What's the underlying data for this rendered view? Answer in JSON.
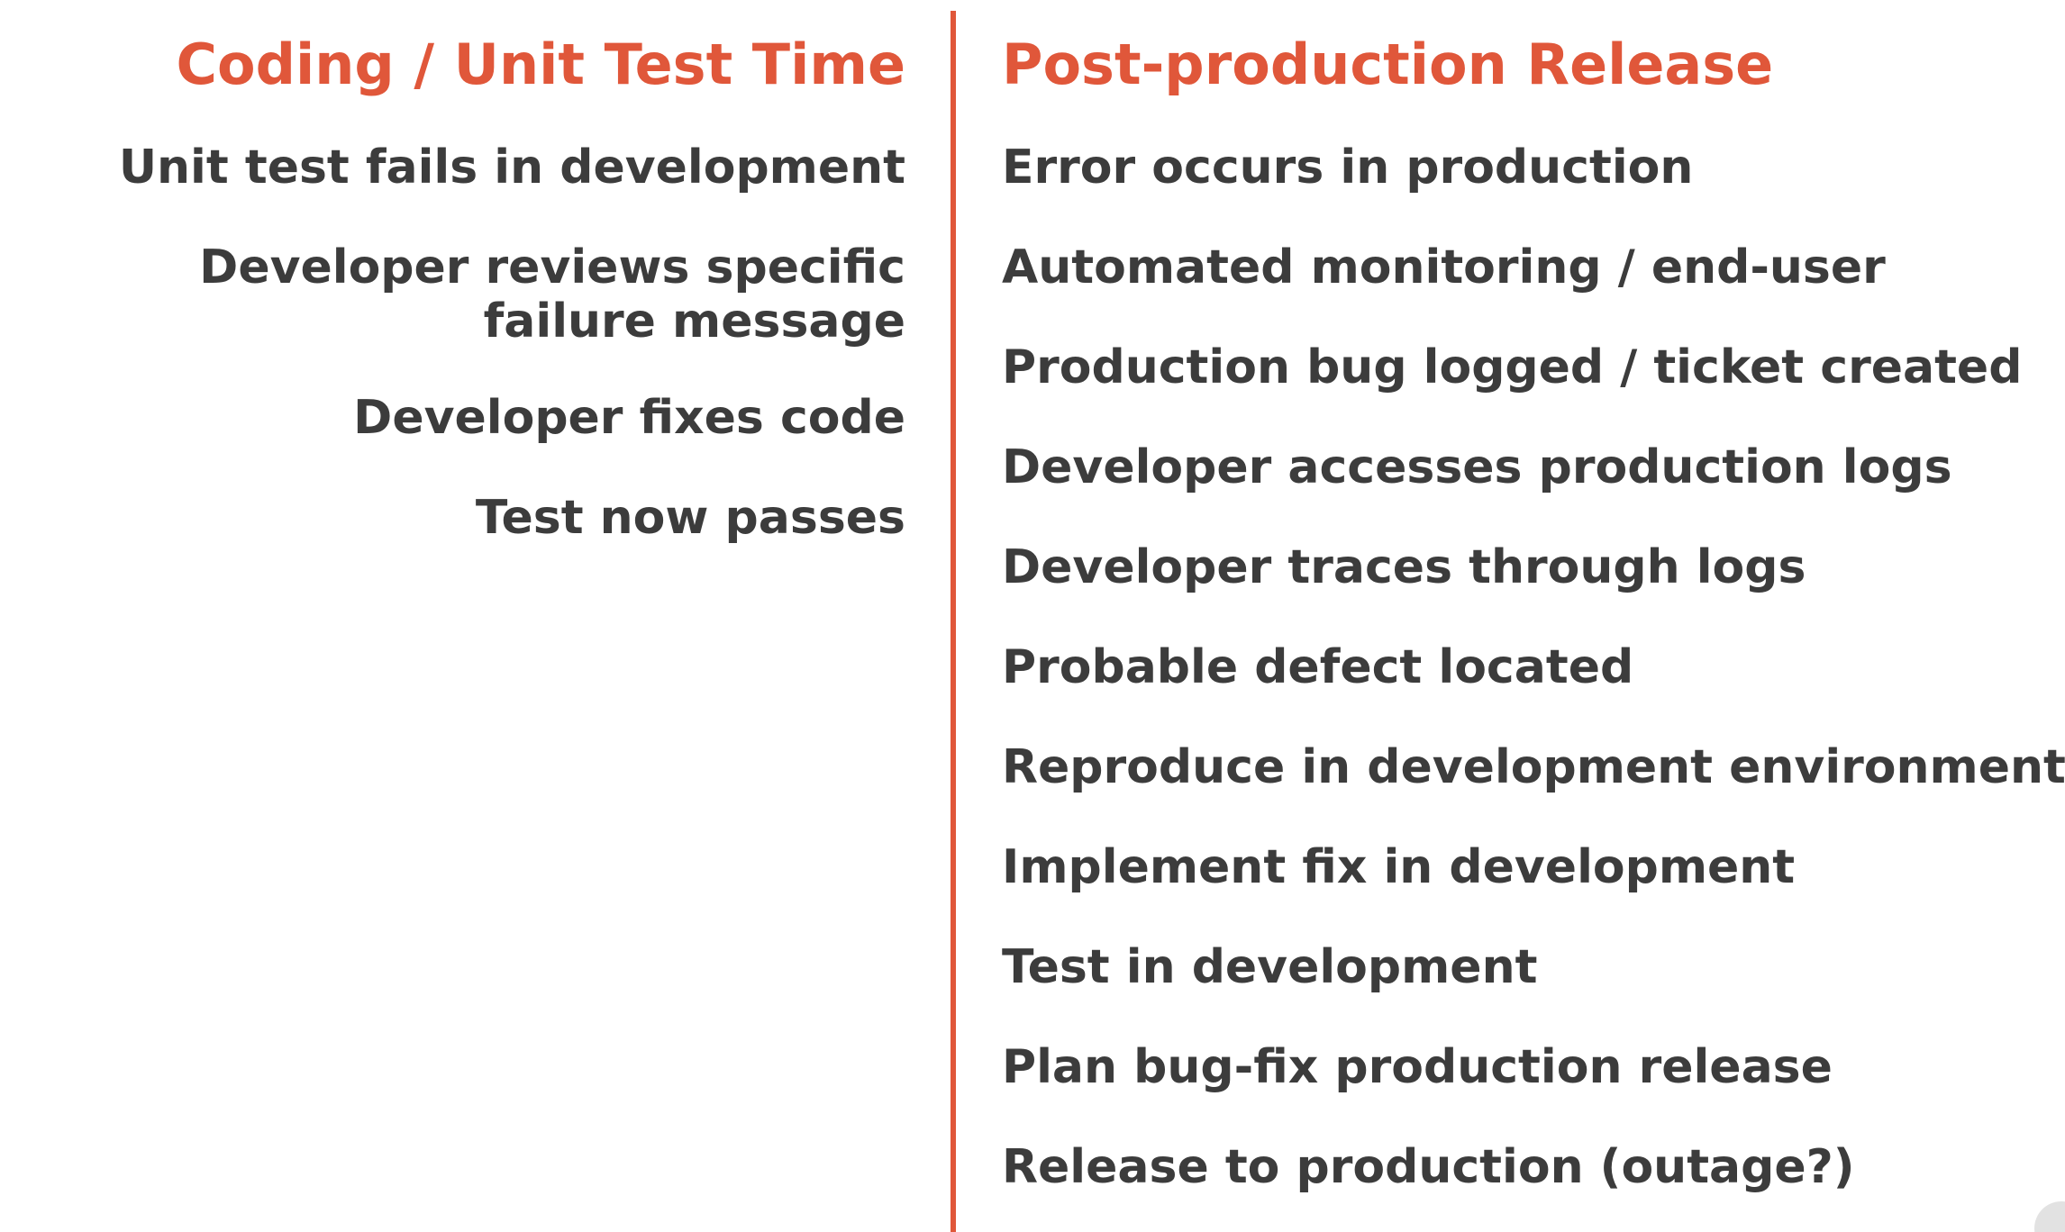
{
  "left_column": {
    "heading": "Coding / Unit Test Time",
    "items": [
      "Unit test fails in development",
      "Developer reviews specific failure message",
      "Developer fixes code",
      "Test now passes"
    ]
  },
  "right_column": {
    "heading": "Post-production Release",
    "items": [
      "Error occurs in production",
      "Automated monitoring / end-user",
      "Production bug logged / ticket created",
      "Developer accesses  production logs",
      "Developer traces through logs",
      "Probable defect located",
      "Reproduce in development environment",
      "Implement fix in development",
      "Test in development",
      "Plan bug-fix production release",
      "Release to production (outage?)"
    ]
  },
  "colors": {
    "accent": "#e0573a",
    "text": "#3c3c3c",
    "background": "#ffffff"
  }
}
